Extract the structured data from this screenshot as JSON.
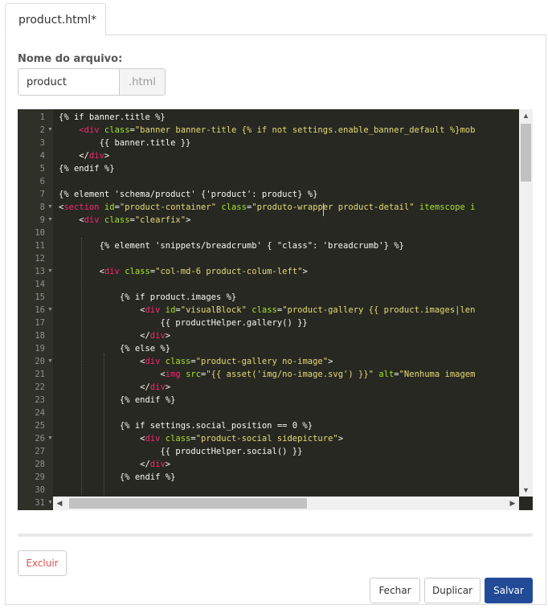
{
  "tab": {
    "title": "product.html*"
  },
  "form": {
    "filename_label": "Nome do arquivo:",
    "filename_value": "product",
    "filename_suffix": ".html"
  },
  "editor": {
    "lines": [
      {
        "n": "1",
        "fold": false,
        "tokens": [
          [
            "t",
            "{% if banner.title %}"
          ]
        ]
      },
      {
        "n": "2",
        "fold": true,
        "tokens": [
          [
            "t",
            "    "
          ],
          [
            "g",
            "<"
          ],
          [
            "g",
            "div"
          ],
          [
            "t",
            " "
          ],
          [
            "a",
            "class"
          ],
          [
            "t",
            "="
          ],
          [
            "s",
            "\"banner banner-title {% if not settings.enable_banner_default %}mob"
          ]
        ]
      },
      {
        "n": "3",
        "fold": false,
        "tokens": [
          [
            "t",
            "        {{ banner.title }}"
          ]
        ]
      },
      {
        "n": "4",
        "fold": false,
        "tokens": [
          [
            "t",
            "    </"
          ],
          [
            "g",
            "div"
          ],
          [
            "t",
            ">"
          ]
        ]
      },
      {
        "n": "5",
        "fold": false,
        "tokens": [
          [
            "t",
            "{% endif %}"
          ]
        ]
      },
      {
        "n": "6",
        "fold": false,
        "tokens": [
          [
            "t",
            ""
          ]
        ]
      },
      {
        "n": "7",
        "fold": false,
        "tokens": [
          [
            "t",
            "{% element 'schema/product' {'product': product} %}"
          ]
        ]
      },
      {
        "n": "8",
        "fold": true,
        "tokens": [
          [
            "t",
            "<"
          ],
          [
            "g",
            "section"
          ],
          [
            "t",
            " "
          ],
          [
            "a",
            "id"
          ],
          [
            "t",
            "="
          ],
          [
            "s",
            "\"product-container\""
          ],
          [
            "t",
            " "
          ],
          [
            "a",
            "class"
          ],
          [
            "t",
            "="
          ],
          [
            "s",
            "\"produto-wrapper product-detail\""
          ],
          [
            "t",
            " "
          ],
          [
            "a",
            "itemscope"
          ],
          [
            "t",
            " "
          ],
          [
            "a",
            "i"
          ]
        ]
      },
      {
        "n": "9",
        "fold": true,
        "tokens": [
          [
            "t",
            "    <"
          ],
          [
            "g",
            "div"
          ],
          [
            "t",
            " "
          ],
          [
            "a",
            "class"
          ],
          [
            "t",
            "="
          ],
          [
            "s",
            "\"clearfix\""
          ],
          [
            "t",
            ">"
          ]
        ]
      },
      {
        "n": "10",
        "fold": false,
        "tokens": [
          [
            "t",
            ""
          ]
        ]
      },
      {
        "n": "11",
        "fold": false,
        "tokens": [
          [
            "t",
            "        {% element 'snippets/breadcrumb' { \"class\": 'breadcrumb'} %}"
          ]
        ]
      },
      {
        "n": "12",
        "fold": false,
        "tokens": [
          [
            "t",
            ""
          ]
        ]
      },
      {
        "n": "13",
        "fold": true,
        "tokens": [
          [
            "t",
            "        <"
          ],
          [
            "g",
            "div"
          ],
          [
            "t",
            " "
          ],
          [
            "a",
            "class"
          ],
          [
            "t",
            "="
          ],
          [
            "s",
            "\"col-md-6 product-colum-left\""
          ],
          [
            "t",
            ">"
          ]
        ]
      },
      {
        "n": "14",
        "fold": false,
        "tokens": [
          [
            "t",
            ""
          ]
        ]
      },
      {
        "n": "15",
        "fold": false,
        "tokens": [
          [
            "t",
            "            {% if product.images %}"
          ]
        ]
      },
      {
        "n": "16",
        "fold": true,
        "tokens": [
          [
            "t",
            "                <"
          ],
          [
            "g",
            "div"
          ],
          [
            "t",
            " "
          ],
          [
            "a",
            "id"
          ],
          [
            "t",
            "="
          ],
          [
            "s",
            "\"visualBlock\""
          ],
          [
            "t",
            " "
          ],
          [
            "a",
            "class"
          ],
          [
            "t",
            "="
          ],
          [
            "s",
            "\"product-gallery {{ product.images|len"
          ]
        ]
      },
      {
        "n": "17",
        "fold": false,
        "tokens": [
          [
            "t",
            "                    {{ productHelper.gallery() }}"
          ]
        ]
      },
      {
        "n": "18",
        "fold": false,
        "tokens": [
          [
            "t",
            "                </"
          ],
          [
            "g",
            "div"
          ],
          [
            "t",
            ">"
          ]
        ]
      },
      {
        "n": "19",
        "fold": false,
        "tokens": [
          [
            "t",
            "            {% else %}"
          ]
        ]
      },
      {
        "n": "20",
        "fold": true,
        "tokens": [
          [
            "t",
            "                <"
          ],
          [
            "g",
            "div"
          ],
          [
            "t",
            " "
          ],
          [
            "a",
            "class"
          ],
          [
            "t",
            "="
          ],
          [
            "s",
            "\"product-gallery no-image\""
          ],
          [
            "t",
            ">"
          ]
        ]
      },
      {
        "n": "21",
        "fold": false,
        "tokens": [
          [
            "t",
            "                    <"
          ],
          [
            "g",
            "img"
          ],
          [
            "t",
            " "
          ],
          [
            "a",
            "src"
          ],
          [
            "t",
            "="
          ],
          [
            "s",
            "\"{{ asset('img/no-image.svg') }}\""
          ],
          [
            "t",
            " "
          ],
          [
            "a",
            "alt"
          ],
          [
            "t",
            "="
          ],
          [
            "s",
            "\"Nenhuma imagem"
          ]
        ]
      },
      {
        "n": "22",
        "fold": false,
        "tokens": [
          [
            "t",
            "                </"
          ],
          [
            "g",
            "div"
          ],
          [
            "t",
            ">"
          ]
        ]
      },
      {
        "n": "23",
        "fold": false,
        "tokens": [
          [
            "t",
            "            {% endif %}"
          ]
        ]
      },
      {
        "n": "24",
        "fold": false,
        "tokens": [
          [
            "t",
            ""
          ]
        ]
      },
      {
        "n": "25",
        "fold": false,
        "tokens": [
          [
            "t",
            "            {% if settings.social_position == 0 %}"
          ]
        ]
      },
      {
        "n": "26",
        "fold": true,
        "tokens": [
          [
            "t",
            "                <"
          ],
          [
            "g",
            "div"
          ],
          [
            "t",
            " "
          ],
          [
            "a",
            "class"
          ],
          [
            "t",
            "="
          ],
          [
            "s",
            "\"product-social sidepicture\""
          ],
          [
            "t",
            ">"
          ]
        ]
      },
      {
        "n": "27",
        "fold": false,
        "tokens": [
          [
            "t",
            "                    {{ productHelper.social() }}"
          ]
        ]
      },
      {
        "n": "28",
        "fold": false,
        "tokens": [
          [
            "t",
            "                </"
          ],
          [
            "g",
            "div"
          ],
          [
            "t",
            ">"
          ]
        ]
      },
      {
        "n": "29",
        "fold": false,
        "tokens": [
          [
            "t",
            "            {% endif %}"
          ]
        ]
      },
      {
        "n": "30",
        "fold": false,
        "tokens": [
          [
            "t",
            ""
          ]
        ]
      },
      {
        "n": "31",
        "fold": true,
        "tokens": [
          [
            "t",
            ""
          ]
        ]
      }
    ]
  },
  "buttons": {
    "delete": "Excluir",
    "close": "Fechar",
    "duplicate": "Duplicar",
    "save": "Salvar"
  },
  "colors": {
    "editor_bg": "#272822",
    "save_button": "#234a96",
    "delete_text": "#d9534f"
  }
}
